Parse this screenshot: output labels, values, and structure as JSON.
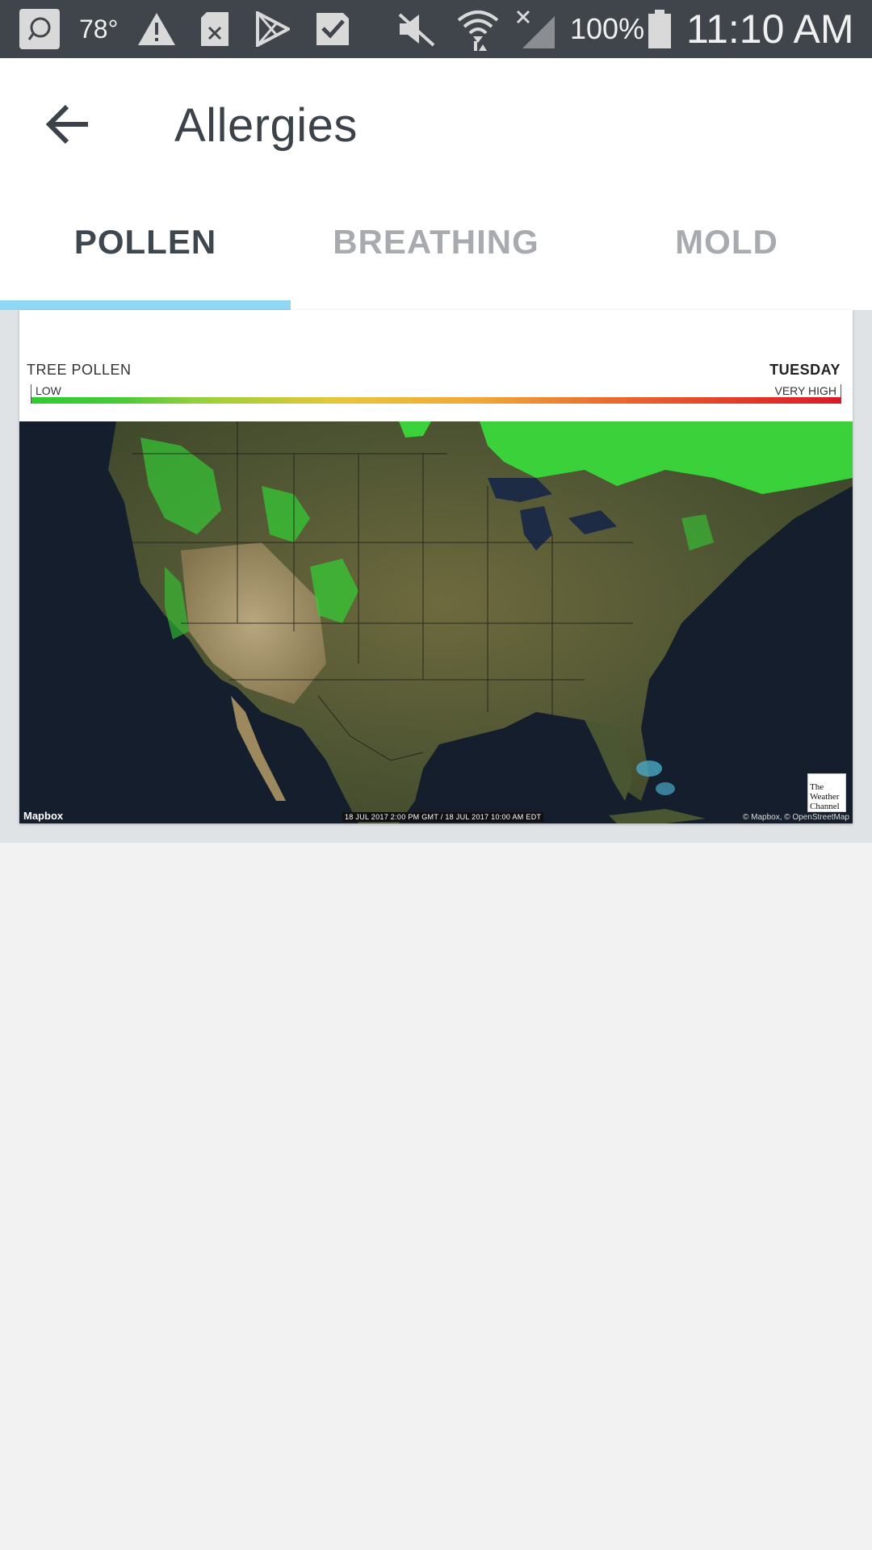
{
  "status_bar": {
    "temperature": "78°",
    "battery": "100%",
    "time": "11:10 AM",
    "icons": [
      "sync-icon",
      "warning-icon",
      "sd-card-x-icon",
      "play-store-icon",
      "check-icon",
      "mute-icon",
      "wifi-icon",
      "no-signal-icon",
      "battery-icon"
    ]
  },
  "app_bar": {
    "title": "Allergies",
    "back_icon": "arrow-left-icon"
  },
  "tabs": [
    {
      "label": "POLLEN",
      "active": true
    },
    {
      "label": "BREATHING",
      "active": false
    },
    {
      "label": "MOLD",
      "active": false
    }
  ],
  "card": {
    "legend_title": "TREE POLLEN",
    "day": "TUESDAY",
    "scale_low": "LOW",
    "scale_high": "VERY HIGH",
    "map_brand": "Mapbox",
    "timestamp": "18 JUL 2017 2:00 PM GMT / 18 JUL 2017 10:00 AM EDT",
    "attribution": "© Mapbox, © OpenStreetMap",
    "logo_text": "The Weather Channel"
  },
  "colors": {
    "status_bar": "#3f454b",
    "tab_indicator": "#8fd7f5",
    "title": "#3b4249",
    "pollen_low": "#2ecb35",
    "pollen_high": "#d91a2a"
  }
}
